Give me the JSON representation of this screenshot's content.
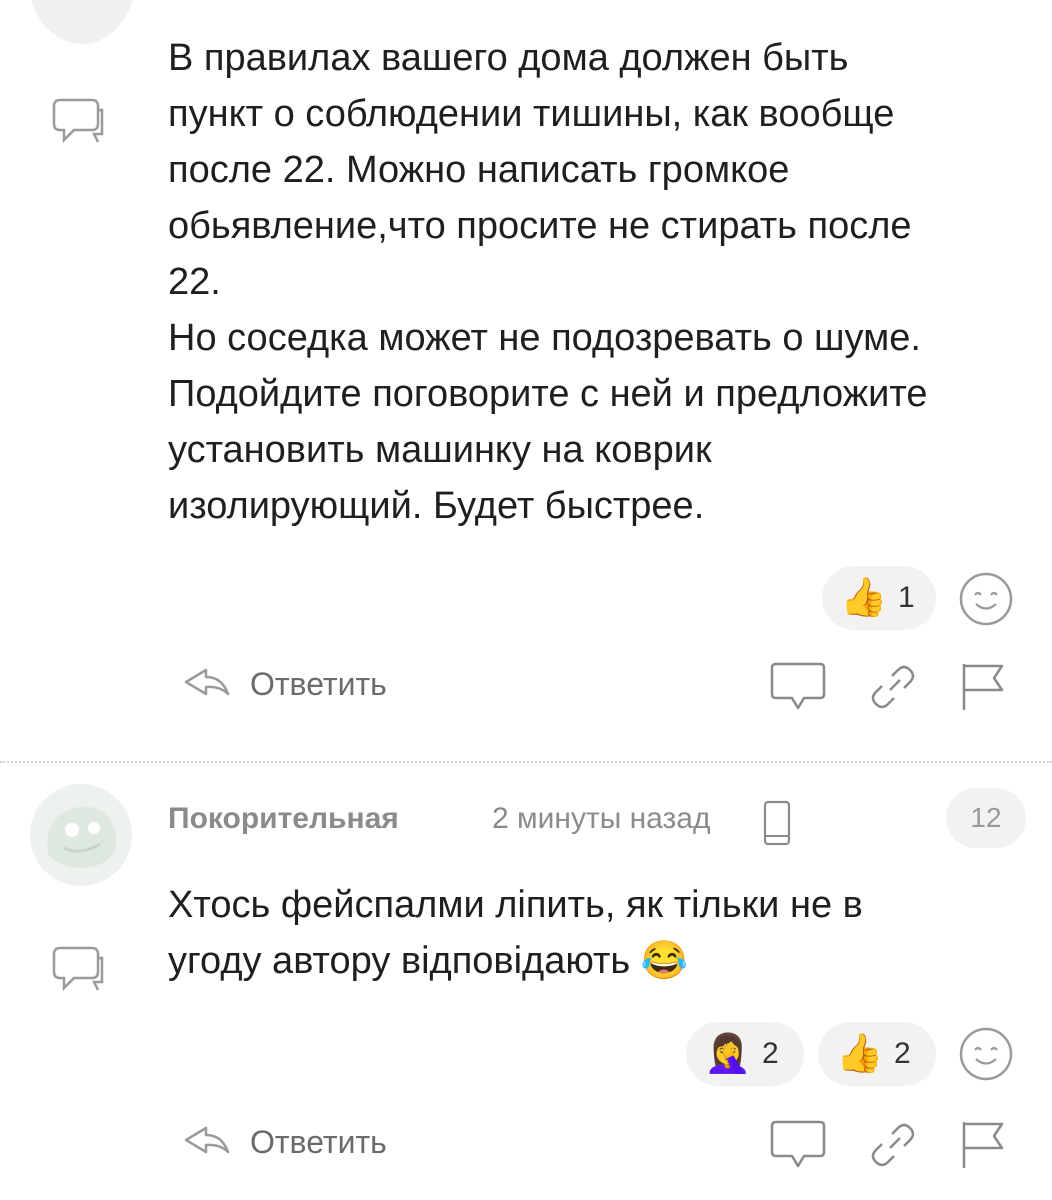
{
  "comment1": {
    "text_lines": [
      "В правилах вашего дома должен быть",
      "пункт о соблюдении тишины, как вообще",
      "после 22. Можно написать громкое",
      "обьявление,что просите не стирать после",
      "22.",
      "Но соседка может не подозревать о шуме.",
      "Подойдите поговорите с ней и предложите",
      "установить машинку на коврик",
      "изолирующий. Будет быстрее."
    ],
    "reactions": [
      {
        "emoji": "👍",
        "count": "1"
      }
    ],
    "reply_label": "Ответить"
  },
  "comment2": {
    "author": "Покорительная",
    "time": "2 минуты назад",
    "badge": "12",
    "text_lines": [
      "Хтось фейспалми ліпить, як тільки не в",
      "угоду автору відповідають 😂"
    ],
    "reactions": [
      {
        "emoji": "🤦‍♀️",
        "count": "2"
      },
      {
        "emoji": "👍",
        "count": "2"
      }
    ],
    "reply_label": "Ответить"
  },
  "icons": {
    "comment": "comment-bubble-icon",
    "emoji_add": "smiley-icon",
    "reply": "reply-arrow-icon",
    "share_chat": "chat-bubble-icon",
    "link": "link-icon",
    "report": "flag-icon",
    "device": "phone-icon"
  },
  "colors": {
    "text": "#1f1f1f",
    "muted": "#8b8b8b",
    "pill_bg": "#f2f2f2"
  }
}
